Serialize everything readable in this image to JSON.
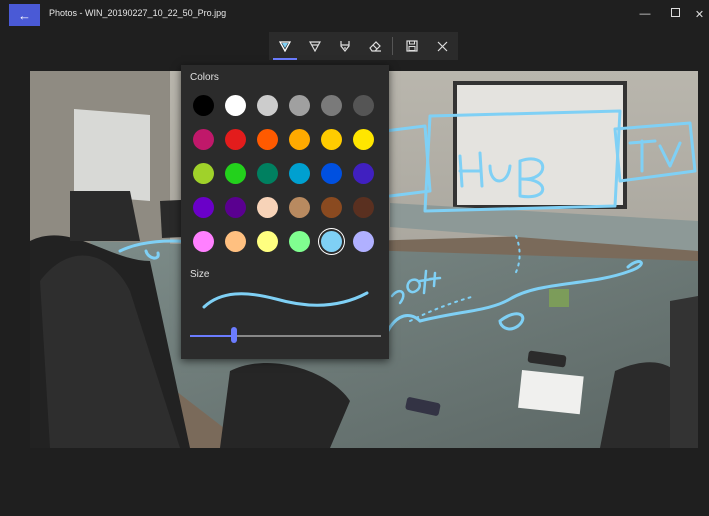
{
  "window": {
    "title": "Photos - WIN_20190227_10_22_50_Pro.jpg",
    "back_icon": "arrow-left-icon",
    "controls": [
      "minimize-icon",
      "maximize-icon",
      "close-icon"
    ]
  },
  "toolbar": {
    "tools": [
      {
        "name": "ballpoint-pen",
        "icon": "ballpoint-pen-icon",
        "active": true
      },
      {
        "name": "pencil",
        "icon": "pencil-icon",
        "active": false
      },
      {
        "name": "calligraphy-pen",
        "icon": "calligraphy-pen-icon",
        "active": false
      },
      {
        "name": "eraser",
        "icon": "eraser-icon",
        "active": false
      }
    ],
    "actions": [
      "save-icon",
      "close-icon"
    ],
    "accent": "#6b7cff"
  },
  "flyout": {
    "colors_label": "Colors",
    "size_label": "Size",
    "selected_color": "#7fd0f5",
    "swatches": [
      [
        "#000000",
        "#ffffff",
        "#cccccc",
        "#a0a0a0",
        "#7a7a7a",
        "#555555"
      ],
      [
        "#c0186a",
        "#e31c1c",
        "#ff5a00",
        "#ffaa00",
        "#ffcc00",
        "#ffe600"
      ],
      [
        "#a0d22a",
        "#23d11c",
        "#008060",
        "#00a0d0",
        "#0050e0",
        "#4020c0"
      ],
      [
        "#6a00c8",
        "#5a0090",
        "#f7d3b8",
        "#b88a60",
        "#8a4a20",
        "#5a3020"
      ],
      [
        "#ff80ff",
        "#ffc080",
        "#ffff80",
        "#80ff90",
        "#7fd0f5",
        "#b0b0ff"
      ]
    ],
    "size_value": 0.23
  }
}
